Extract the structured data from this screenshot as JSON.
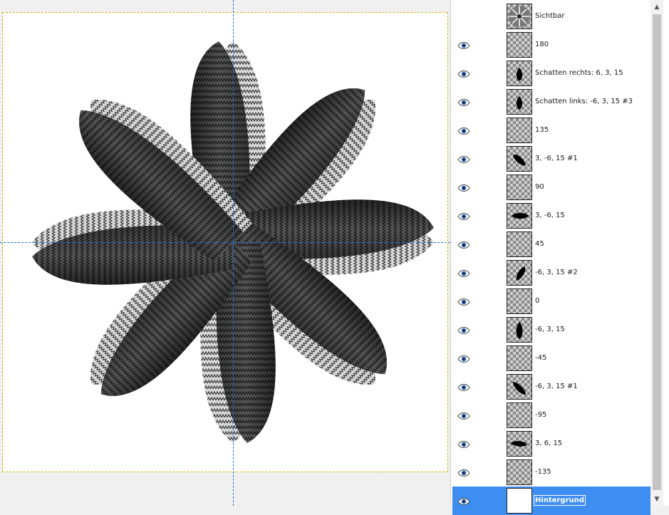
{
  "canvas": {
    "artwork_name": "flower-artwork"
  },
  "layers_panel": {
    "layers": [
      {
        "name": "Sichtbar",
        "visible": false,
        "thumb": "flower"
      },
      {
        "name": "180",
        "visible": true,
        "thumb": "empty"
      },
      {
        "name": "Schatten rechts: 6, 3, 15",
        "visible": true,
        "thumb": "blob-small-v"
      },
      {
        "name": "Schatten links: -6, 3, 15 #3",
        "visible": true,
        "thumb": "blob-small-v"
      },
      {
        "name": "135",
        "visible": true,
        "thumb": "empty"
      },
      {
        "name": "3, -6, 15 #1",
        "visible": true,
        "thumb": "blob-diag"
      },
      {
        "name": "90",
        "visible": true,
        "thumb": "empty"
      },
      {
        "name": "3, -6, 15",
        "visible": true,
        "thumb": "blob-h"
      },
      {
        "name": "45",
        "visible": true,
        "thumb": "empty"
      },
      {
        "name": "-6, 3, 15 #2",
        "visible": true,
        "thumb": "blob-diag2"
      },
      {
        "name": "0",
        "visible": true,
        "thumb": "empty"
      },
      {
        "name": "-6, 3, 15",
        "visible": true,
        "thumb": "blob-v"
      },
      {
        "name": "-45",
        "visible": true,
        "thumb": "empty"
      },
      {
        "name": "-6, 3, 15 #1",
        "visible": true,
        "thumb": "blob-diag3"
      },
      {
        "name": "-95",
        "visible": true,
        "thumb": "empty"
      },
      {
        "name": "3, 6, 15",
        "visible": true,
        "thumb": "blob-h2"
      },
      {
        "name": "-135",
        "visible": true,
        "thumb": "empty"
      },
      {
        "name": "Hintergrund",
        "visible": true,
        "thumb": "white",
        "active": true
      }
    ]
  },
  "colors": {
    "guide": "#1e74d6",
    "selection": "#3d8ef0",
    "boundary": "#c8b400"
  }
}
